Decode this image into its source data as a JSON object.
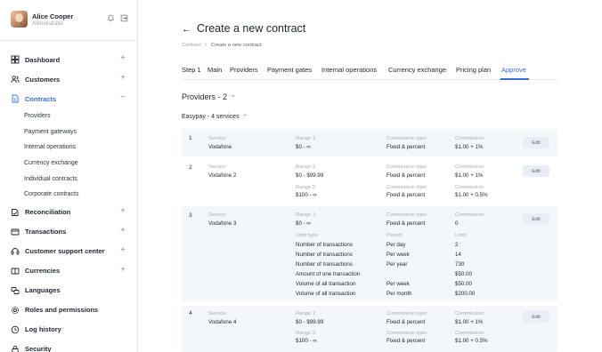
{
  "user": {
    "name": "Alice Cooper",
    "role": "Administrator",
    "icons": [
      "bell-icon",
      "logout-icon"
    ]
  },
  "sidebar": {
    "items": [
      {
        "label": "Dashboard",
        "icon": "dashboard-icon",
        "toggle": "+"
      },
      {
        "label": "Customers",
        "icon": "users-icon",
        "toggle": "+"
      },
      {
        "label": "Contracts",
        "icon": "document-icon",
        "toggle": "−",
        "active": true,
        "children": [
          "Providers",
          "Payment gateways",
          "Internal operations",
          "Currency exchange",
          "Individual contracts",
          "Corporate contracts"
        ]
      },
      {
        "label": "Reconciliation",
        "icon": "reconciliation-icon",
        "toggle": "+"
      },
      {
        "label": "Transactions",
        "icon": "transactions-icon",
        "toggle": "+"
      },
      {
        "label": "Customer support center",
        "icon": "support-icon",
        "toggle": "+"
      },
      {
        "label": "Currencies",
        "icon": "currency-icon",
        "toggle": "+"
      },
      {
        "label": "Languages",
        "icon": "languages-icon",
        "toggle": ""
      },
      {
        "label": "Roles and permissions",
        "icon": "gear-icon",
        "toggle": ""
      },
      {
        "label": "Log history",
        "icon": "history-icon",
        "toggle": ""
      },
      {
        "label": "Security",
        "icon": "lock-icon",
        "toggle": ""
      }
    ]
  },
  "header": {
    "back_icon": "←",
    "title": "Create a new contract",
    "breadcrumb": [
      "Contract",
      "Create a new contract"
    ],
    "breadcrumb_sep": "/"
  },
  "tabs": [
    "Step 1",
    "Main",
    "Providers",
    "Payment gates",
    "Internal operations",
    "Currency exchange",
    "Pricing plan",
    "Approve"
  ],
  "active_tab": "Approve",
  "section": {
    "title": "Providers - 2",
    "chevron": "⌃"
  },
  "subsection": {
    "title": "Easypay - 4 services",
    "chevron": "⌃"
  },
  "labels": {
    "service": "Service:",
    "range1": "Range 1:",
    "range2": "Range 2:",
    "commission_type": "Commission type:",
    "commission": "Commission:",
    "limit_type": "Limit type:",
    "period": "Period:",
    "limit": "Limit:",
    "edit": "Edit"
  },
  "services": [
    {
      "no": "1",
      "name": "Vodafone",
      "ranges": [
        {
          "range": "$0 - ∞",
          "type": "Fixed & percent",
          "commission": "$1.00 + 1%"
        }
      ]
    },
    {
      "no": "2",
      "name": "Vodafone 2",
      "ranges": [
        {
          "range": "$0 - $99.99",
          "type": "Fixed & percent",
          "commission": "$1.00 + 1%"
        },
        {
          "range": "$100 - ∞",
          "type": "Fixed & percent",
          "commission": "$1.00 + 0.5%"
        }
      ]
    },
    {
      "no": "3",
      "name": "Vodafone 3",
      "ranges": [
        {
          "range": "$0 - ∞",
          "type": "Fixed & percent",
          "commission": "0"
        }
      ],
      "limits": [
        {
          "type": "Number of transactions",
          "period": "Per day",
          "limit": "2"
        },
        {
          "type": "Number of transactions",
          "period": "Per week",
          "limit": "14"
        },
        {
          "type": "Number of transactions",
          "period": "Per year",
          "limit": "730"
        },
        {
          "type": "Amount of one transaction",
          "period": "",
          "limit": "$50.00"
        },
        {
          "type": "Volume of all transaction",
          "period": "Per week",
          "limit": "$50.00"
        },
        {
          "type": "Volume of all transaction",
          "period": "Per month",
          "limit": "$200.00"
        }
      ]
    },
    {
      "no": "4",
      "name": "Vodafone 4",
      "ranges": [
        {
          "range": "$0 - $99.99",
          "type": "Fixed & percent",
          "commission": "$1.00 + 1%"
        },
        {
          "range": "$100 - ∞",
          "type": "Fixed & percent",
          "commission": "$1.00 + 0.5%"
        }
      ]
    }
  ],
  "colors": {
    "accent": "#3b6fd8",
    "row_shade": "#f3f6fb",
    "muted": "#a5acb8"
  }
}
